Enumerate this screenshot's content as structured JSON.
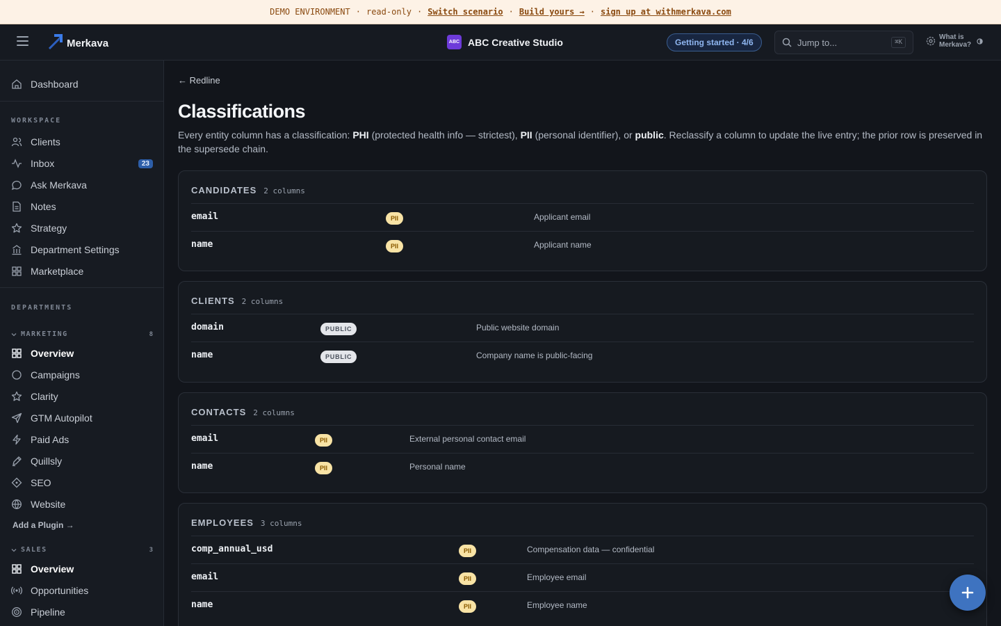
{
  "banner": {
    "env": "DEMO ENVIRONMENT",
    "sep1": "·",
    "mode": "read-only",
    "sep2": "·",
    "switch_link": "Switch scenario",
    "sep3": "·",
    "build_link": "Build yours →",
    "sep4": "·",
    "signup_link": "sign up at withmerkava.com"
  },
  "header": {
    "app_name": "Merkava",
    "org_badge": "ABC",
    "org_name": "ABC Creative Studio",
    "getting_started": "Getting started · 4/6",
    "search_placeholder": "Jump to...",
    "search_shortcut": "⌘K",
    "what_is": "What is Merkava?"
  },
  "sidebar": {
    "dashboard": "Dashboard",
    "workspace_label": "WORKSPACE",
    "workspace_items": [
      {
        "label": "Clients",
        "icon": "users-icon"
      },
      {
        "label": "Inbox",
        "icon": "activity-icon",
        "badge": "23"
      },
      {
        "label": "Ask Merkava",
        "icon": "chat-icon"
      },
      {
        "label": "Notes",
        "icon": "note-icon"
      },
      {
        "label": "Strategy",
        "icon": "star-icon"
      },
      {
        "label": "Department Settings",
        "icon": "building-icon"
      },
      {
        "label": "Marketplace",
        "icon": "grid-icon"
      }
    ],
    "departments_label": "DEPARTMENTS",
    "marketing": {
      "label": "MARKETING",
      "count": "8",
      "items": [
        {
          "label": "Overview",
          "icon": "grid-icon",
          "active": true
        },
        {
          "label": "Campaigns",
          "icon": "circle-icon"
        },
        {
          "label": "Clarity",
          "icon": "star-icon"
        },
        {
          "label": "GTM Autopilot",
          "icon": "send-icon"
        },
        {
          "label": "Paid Ads",
          "icon": "bolt-icon"
        },
        {
          "label": "Quillsly",
          "icon": "pen-icon"
        },
        {
          "label": "SEO",
          "icon": "diamond-icon"
        },
        {
          "label": "Website",
          "icon": "globe-icon"
        }
      ]
    },
    "add_plugin": "Add a Plugin →",
    "sales": {
      "label": "SALES",
      "count": "3",
      "items": [
        {
          "label": "Overview",
          "icon": "grid-icon",
          "active": true
        },
        {
          "label": "Opportunities",
          "icon": "broadcast-icon"
        },
        {
          "label": "Pipeline",
          "icon": "target-icon"
        }
      ]
    }
  },
  "main": {
    "back": "← Redline",
    "title": "Classifications",
    "desc_1": "Every entity column has a classification: ",
    "desc_phi": "PHI",
    "desc_2": " (protected health info — strictest), ",
    "desc_pii": "PII",
    "desc_3": " (personal identifier), or ",
    "desc_public": "public",
    "desc_4": ". Reclassify a column to update the live entry; the prior row is preserved in the supersede chain.",
    "entities": [
      {
        "name": "CANDIDATES",
        "count": "2 columns",
        "rows": [
          {
            "column": "email",
            "class": "PII",
            "desc": "Applicant email"
          },
          {
            "column": "name",
            "class": "PII",
            "desc": "Applicant name"
          }
        ]
      },
      {
        "name": "CLIENTS",
        "count": "2 columns",
        "rows": [
          {
            "column": "domain",
            "class": "PUBLIC",
            "desc": "Public website domain"
          },
          {
            "column": "name",
            "class": "PUBLIC",
            "desc": "Company name is public-facing"
          }
        ]
      },
      {
        "name": "CONTACTS",
        "count": "2 columns",
        "rows": [
          {
            "column": "email",
            "class": "PII",
            "desc": "External personal contact email"
          },
          {
            "column": "name",
            "class": "PII",
            "desc": "Personal name"
          }
        ]
      },
      {
        "name": "EMPLOYEES",
        "count": "3 columns",
        "rows": [
          {
            "column": "comp_annual_usd",
            "class": "PII",
            "desc": "Compensation data — confidential"
          },
          {
            "column": "email",
            "class": "PII",
            "desc": "Employee email"
          },
          {
            "column": "name",
            "class": "PII",
            "desc": "Employee name"
          }
        ]
      }
    ]
  },
  "fab": {
    "icon": "plus-icon",
    "label": "+"
  }
}
